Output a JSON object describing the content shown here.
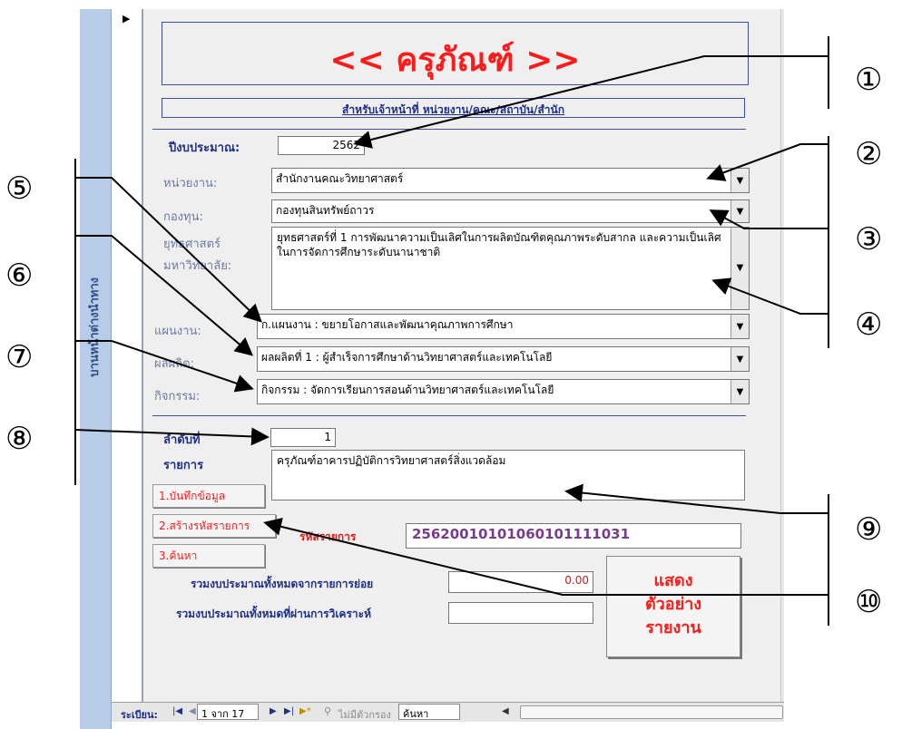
{
  "nav_pane": {
    "label": "บานหน้าต่างนำทาง"
  },
  "record_selector": {
    "arrow": "▶"
  },
  "form": {
    "title": "<< ครุภัณฑ์ >>",
    "subtitle": "สำหรับเจ้าหน้าที่ หน่วยงาน/คณะ/สถาบัน/สำนัก",
    "fiscal_year": {
      "label": "ปีงบประมาณ:",
      "value": "2562"
    },
    "department": {
      "label": "หน่วยงาน:",
      "value": "สำนักงานคณะวิทยาศาสตร์"
    },
    "fund": {
      "label": "กองทุน:",
      "value": "กองทุนสินทรัพย์ถาวร"
    },
    "strategy": {
      "label_line1": "ยุทธศาสตร์",
      "label_line2": "มหาวิทยาลัย:",
      "value": "ยุทธศาสตร์ที่ 1 การพัฒนาความเป็นเลิศในการผลิตบัณฑิตคุณภาพระดับสากล และความเป็นเลิศในการจัดการศึกษาระดับนานาชาติ"
    },
    "plan": {
      "label": "แผนงาน:",
      "value": "ก.แผนงาน : ขยายโอกาสและพัฒนาคุณภาพการศึกษา"
    },
    "output": {
      "label": "ผลผลิต:",
      "value": "ผลผลิตที่ 1 : ผู้สำเร็จการศึกษาด้านวิทยาศาสตร์และเทคโนโลยี"
    },
    "activity": {
      "label": "กิจกรรม:",
      "value": "กิจกรรม : จัดการเรียนการสอนด้านวิทยาศาสตร์และเทคโนโลยี"
    },
    "seq": {
      "label": "ลำดับที่",
      "value": "1"
    },
    "item": {
      "label": "รายการ",
      "value": "ครุภัณฑ์อาคารปฏิบัติการวิทยาศาสตร์สิ่งแวดล้อม"
    },
    "buttons": {
      "save": "1.บันทึกข้อมูล",
      "generate": "2.สร้างรหัสรายการ",
      "search": "3.ค้นหา"
    },
    "item_code": {
      "label": "รหัสรายการ",
      "value": "25620010101060101111031"
    },
    "total_from_items": {
      "label": "รวมงบประมาณทั้งหมดจากรายการย่อย",
      "value": "0.00"
    },
    "total_analyzed": {
      "label": "รวมงบประมาณทั้งหมดที่ผ่านการวิเคราะห์",
      "value": ""
    },
    "report_button": {
      "line1": "แสดง",
      "line2": "ตัวอย่าง",
      "line3": "รายงาน"
    }
  },
  "status_bar": {
    "record_label": "ระเบียน:",
    "first": "|◀",
    "prev": "◀",
    "position": "1 จาก 17",
    "next": "▶",
    "last": "▶|",
    "new": "▶*",
    "filter": "ไม่มีตัวกรอง",
    "search": "ค้นหา",
    "scroll_left": "◀"
  },
  "callouts": [
    "①",
    "②",
    "③",
    "④",
    "⑤",
    "⑥",
    "⑦",
    "⑧",
    "⑨",
    "⑩"
  ]
}
